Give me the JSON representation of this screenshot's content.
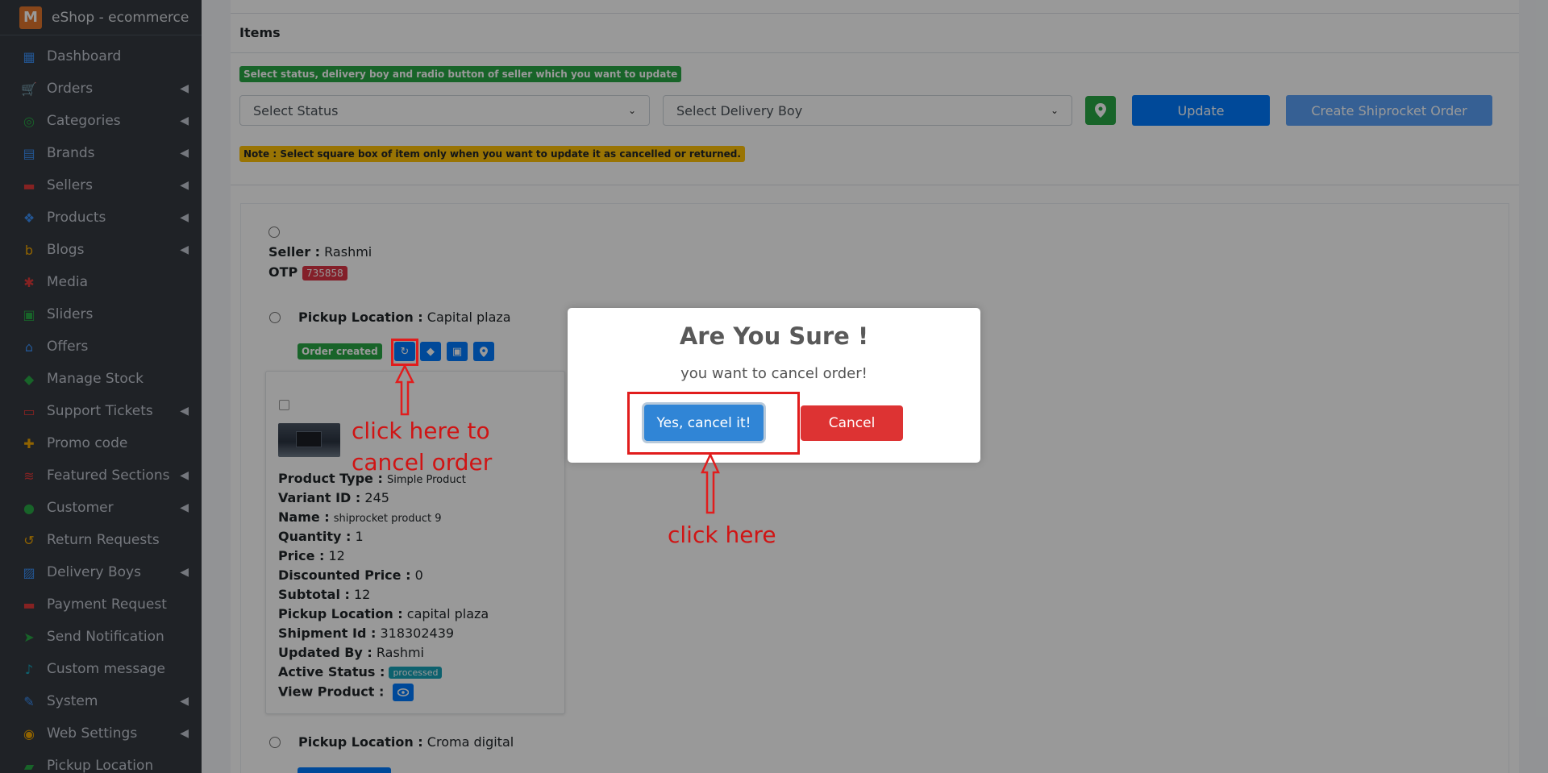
{
  "app": {
    "brand": "eShop - ecommerce"
  },
  "sidebar": {
    "items": [
      {
        "label": "Dashboard",
        "icon": "dashboard-icon",
        "color": "#3b8ff6",
        "glyph": "▦",
        "chevron": false
      },
      {
        "label": "Orders",
        "icon": "cart-icon",
        "color": "#f0a500",
        "glyph": "🛒",
        "chevron": true
      },
      {
        "label": "Categories",
        "icon": "categories-icon",
        "color": "#28a745",
        "glyph": "◎",
        "chevron": true
      },
      {
        "label": "Brands",
        "icon": "brands-icon",
        "color": "#3b8ff6",
        "glyph": "▤",
        "chevron": true
      },
      {
        "label": "Sellers",
        "icon": "store-icon",
        "color": "#e03a3a",
        "glyph": "▬",
        "chevron": true
      },
      {
        "label": "Products",
        "icon": "cubes-icon",
        "color": "#3b8ff6",
        "glyph": "❖",
        "chevron": true
      },
      {
        "label": "Blogs",
        "icon": "blog-icon",
        "color": "#f0a500",
        "glyph": "b",
        "chevron": true
      },
      {
        "label": "Media",
        "icon": "media-icon",
        "color": "#e03a3a",
        "glyph": "✱",
        "chevron": false
      },
      {
        "label": "Sliders",
        "icon": "image-icon",
        "color": "#28a745",
        "glyph": "▣",
        "chevron": false
      },
      {
        "label": "Offers",
        "icon": "gift-icon",
        "color": "#3b8ff6",
        "glyph": "⌂",
        "chevron": false
      },
      {
        "label": "Manage Stock",
        "icon": "cube-icon",
        "color": "#28a745",
        "glyph": "◆",
        "chevron": false
      },
      {
        "label": "Support Tickets",
        "icon": "ticket-icon",
        "color": "#e03a3a",
        "glyph": "▭",
        "chevron": true
      },
      {
        "label": "Promo code",
        "icon": "puzzle-icon",
        "color": "#f0a500",
        "glyph": "✚",
        "chevron": false
      },
      {
        "label": "Featured Sections",
        "icon": "layers-icon",
        "color": "#e03a3a",
        "glyph": "≋",
        "chevron": true
      },
      {
        "label": "Customer",
        "icon": "user-icon",
        "color": "#28a745",
        "glyph": "●",
        "chevron": true
      },
      {
        "label": "Return Requests",
        "icon": "undo-icon",
        "color": "#f0a500",
        "glyph": "↺",
        "chevron": false
      },
      {
        "label": "Delivery Boys",
        "icon": "id-badge-icon",
        "color": "#3b8ff6",
        "glyph": "▨",
        "chevron": true
      },
      {
        "label": "Payment Request",
        "icon": "money-icon",
        "color": "#e03a3a",
        "glyph": "▬",
        "chevron": false
      },
      {
        "label": "Send Notification",
        "icon": "paper-plane-icon",
        "color": "#28a745",
        "glyph": "➤",
        "chevron": false
      },
      {
        "label": "Custom message",
        "icon": "bell-icon",
        "color": "#17a2b8",
        "glyph": "♪",
        "chevron": false
      },
      {
        "label": "System",
        "icon": "wrench-icon",
        "color": "#3b8ff6",
        "glyph": "✎",
        "chevron": true
      },
      {
        "label": "Web Settings",
        "icon": "globe-icon",
        "color": "#f0a500",
        "glyph": "◉",
        "chevron": true
      },
      {
        "label": "Pickup Location",
        "icon": "truck-icon",
        "color": "#28a745",
        "glyph": "▰",
        "chevron": false
      }
    ]
  },
  "items_section": {
    "title": "Items",
    "instruction": "Select status, delivery boy and radio button of seller which you want to update",
    "status_select": "Select Status",
    "delivery_select": "Select Delivery Boy",
    "update_label": "Update",
    "shiprocket_label": "Create Shiprocket Order",
    "note": "Note : Select square box of item only when you want to update it as cancelled or returned."
  },
  "seller": {
    "seller_label": "Seller :",
    "seller_name": "Rashmi",
    "otp_label": "OTP :",
    "otp": "735858",
    "pickup_label": "Pickup Location :",
    "pickup_value": "Capital plaza",
    "status_chip": "Order created"
  },
  "item": {
    "product_type_label": "Product Type :",
    "product_type": "Simple Product",
    "variant_label": "Variant ID :",
    "variant": "245",
    "name_label": "Name :",
    "name": "shiprocket product 9",
    "qty_label": "Quantity :",
    "qty": "1",
    "price_label": "Price :",
    "price": "12",
    "disc_label": "Discounted Price :",
    "disc": "0",
    "subtotal_label": "Subtotal :",
    "subtotal": "12",
    "pickup_label": "Pickup Location :",
    "pickup": "capital plaza",
    "shipment_label": "Shipment Id :",
    "shipment": "318302439",
    "updated_label": "Updated By :",
    "updated": "Rashmi",
    "active_label": "Active Status :",
    "active": "processed",
    "view_label": "View Product :"
  },
  "second_pickup": {
    "label": "Pickup Location :",
    "value": "Croma digital"
  },
  "annotations": {
    "cancel_hint_line1": "click here to",
    "cancel_hint_line2": "cancel order",
    "confirm_hint": "click here"
  },
  "modal": {
    "title": "Are You Sure !",
    "text": "you want to cancel order!",
    "confirm_label": "Yes, cancel it!",
    "cancel_label": "Cancel"
  }
}
